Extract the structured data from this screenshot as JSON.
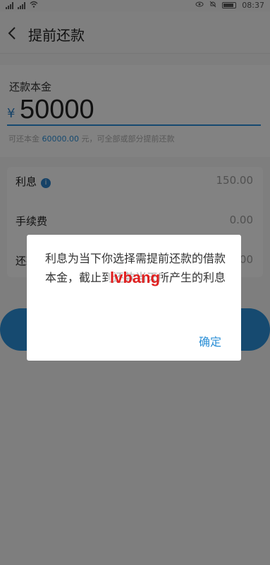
{
  "status_bar": {
    "sim1": "4G",
    "sim2": "4G",
    "time": "08:37"
  },
  "nav": {
    "title": "提前还款",
    "back_icon": "chevron-left-icon"
  },
  "amount": {
    "label": "还款本金",
    "currency": "¥",
    "value": "50000",
    "hint_prefix": "可还本金",
    "hint_amount": "60000.00",
    "hint_suffix": "元，可全部或部分提前还款"
  },
  "details": [
    {
      "label": "利息",
      "value": "150.00",
      "has_info": true
    },
    {
      "label": "手续费",
      "value": "0.00",
      "has_info": false
    },
    {
      "label": "还款总额",
      "value": "50150.00",
      "has_info": false
    }
  ],
  "dialog": {
    "message": "利息为当下你选择需提前还款的借款本金，截止到还款当天所产生的利息",
    "confirm": "确定",
    "watermark": "lvbang"
  },
  "colors": {
    "accent": "#2b8fd6",
    "overlay": "rgba(0,0,0,0.48)"
  }
}
